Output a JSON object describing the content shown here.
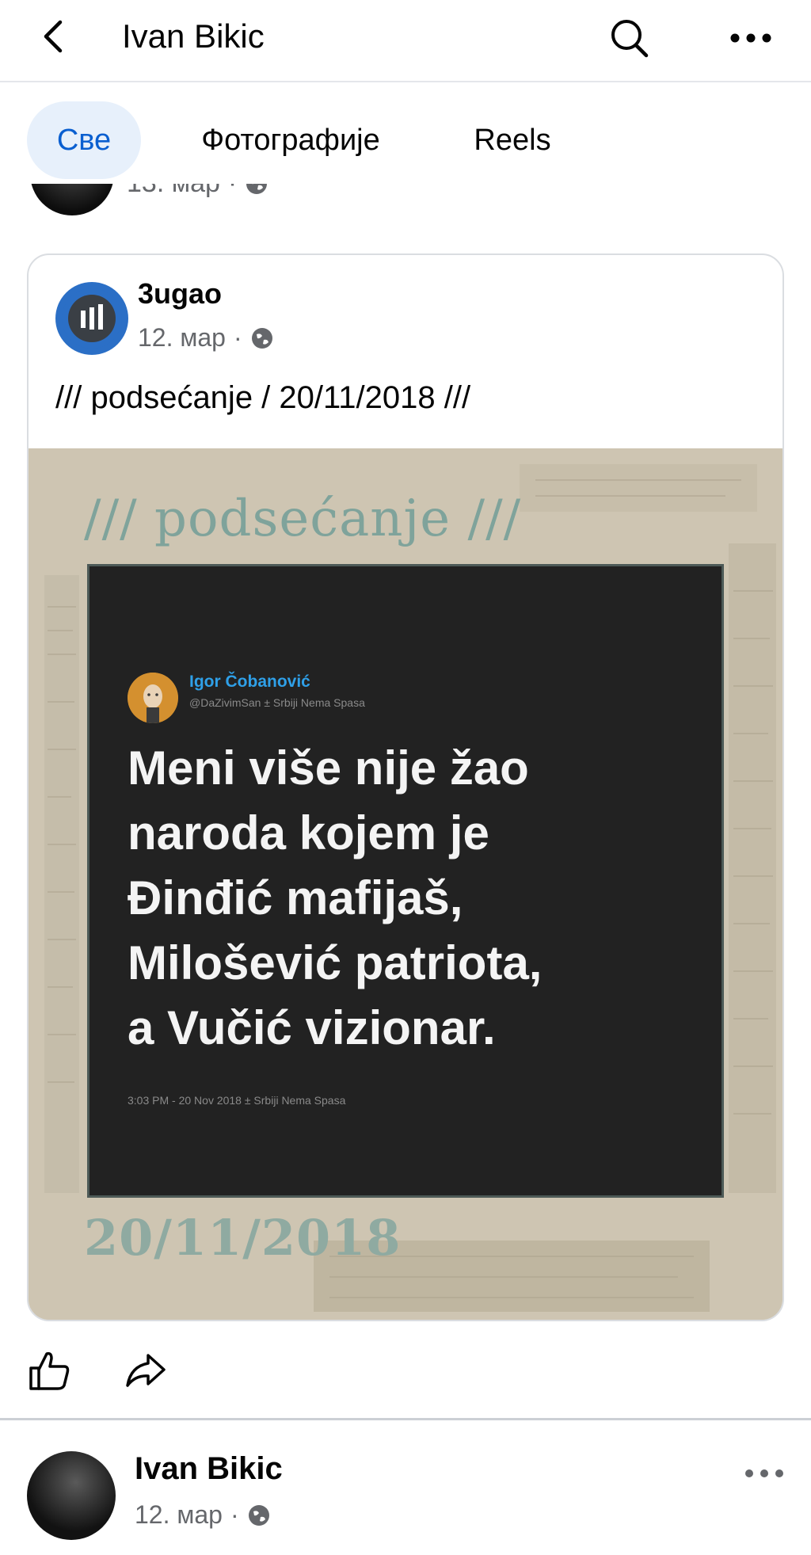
{
  "header": {
    "title": "Ivan Bikic",
    "back_icon": "chevron-left-icon",
    "search_icon": "search-icon",
    "more_icon": "more-horizontal-icon"
  },
  "tabs": [
    {
      "label": "Све",
      "active": true
    },
    {
      "label": "Фотографије",
      "active": false
    },
    {
      "label": "Reels",
      "active": false
    }
  ],
  "previous_post": {
    "date": "13. мар",
    "separator": "·",
    "audience_icon": "globe-icon"
  },
  "shared_post": {
    "page_name": "3ugao",
    "date": "12. мар",
    "separator": "·",
    "audience_icon": "globe-icon",
    "text": "/// podsećanje / 20/11/2018 ///",
    "image": {
      "top_title": "/// podsećanje ///",
      "bottom_date": "20/11/2018",
      "tweet": {
        "author_name": "Igor Čobanović",
        "author_handle": "@DaZivimSan ± Srbiji Nema Spasa",
        "lines": [
          "Meni više nije žao",
          "naroda kojem je",
          "Đinđić mafijaš,",
          "Milošević patriota,",
          "a Vučić vizionar."
        ],
        "footer": "3:03 PM - 20 Nov 2018 ± Srbiji Nema Spasa"
      }
    }
  },
  "actions": {
    "like_icon": "thumbs-up-icon",
    "share_icon": "share-icon"
  },
  "next_post": {
    "author": "Ivan Bikic",
    "date": "12. мар",
    "separator": "·",
    "audience_icon": "globe-icon",
    "more_icon": "more-horizontal-icon"
  },
  "colors": {
    "accent": "#0a5fd0",
    "tab_active_bg": "#e7f0fb",
    "tweet_name": "#2fa0e8",
    "tweet_bg": "#222222",
    "image_bg": "#cfc6b4",
    "image_title": "#7fa39b"
  }
}
